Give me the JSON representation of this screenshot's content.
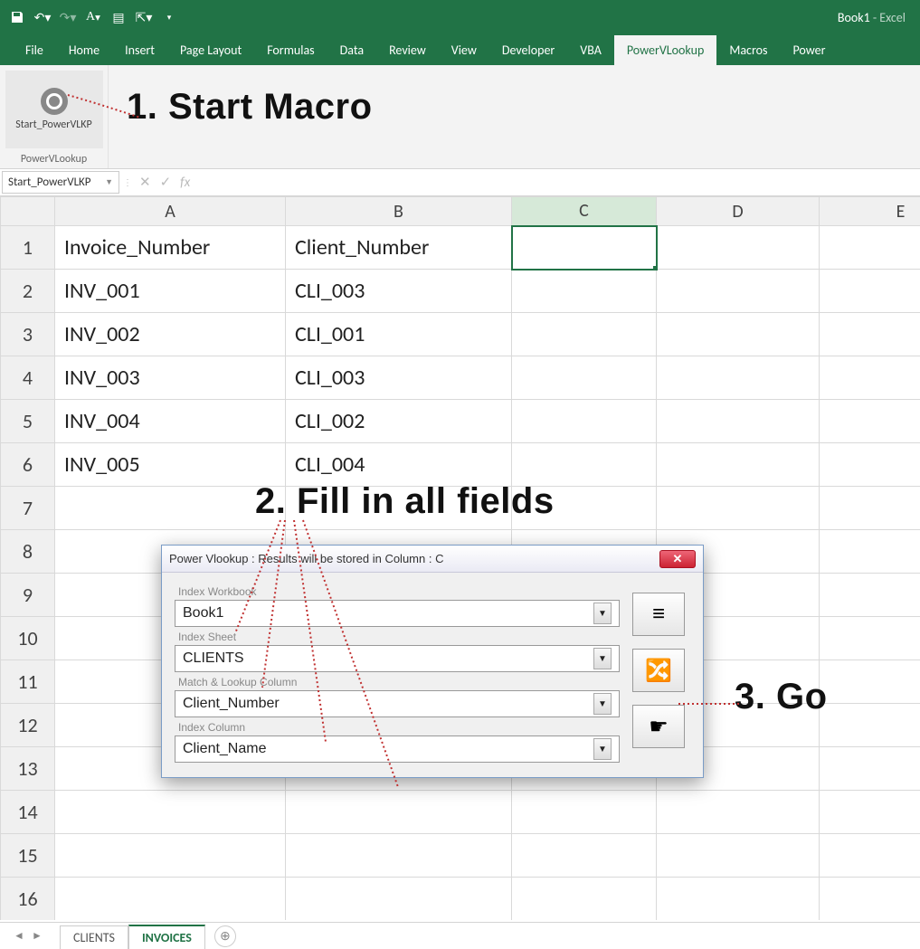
{
  "app": {
    "title": "Book1",
    "suffix": "  -  Excel"
  },
  "tabs": [
    "File",
    "Home",
    "Insert",
    "Page Layout",
    "Formulas",
    "Data",
    "Review",
    "View",
    "Developer",
    "VBA",
    "PowerVLookup",
    "Macros",
    "Power"
  ],
  "active_tab": "PowerVLookup",
  "ribbon": {
    "macro_label": "Start_PowerVLKP",
    "group_label": "PowerVLookup"
  },
  "namebox": "Start_PowerVLKP",
  "columns": [
    "A",
    "B",
    "C",
    "D",
    "E"
  ],
  "rows": [
    1,
    2,
    3,
    4,
    5,
    6,
    7,
    8,
    9,
    10,
    11,
    12,
    13,
    14,
    15,
    16
  ],
  "cells": {
    "A1": "Invoice_Number",
    "B1": "Client_Number",
    "A2": "INV_001",
    "B2": "CLI_003",
    "A3": "INV_002",
    "B3": "CLI_001",
    "A4": "INV_003",
    "B4": "CLI_003",
    "A5": "INV_004",
    "B5": "CLI_002",
    "A6": "INV_005",
    "B6": "CLI_004"
  },
  "selected_cell": "C1",
  "dialog": {
    "title": "Power Vlookup : Results will be stored in Column : C",
    "f1_label": "Index Workbook",
    "f1_value": "Book1",
    "f2_label": "Index Sheet",
    "f2_value": "CLIENTS",
    "f3_label": "Match & Lookup Column",
    "f3_value": "Client_Number",
    "f4_label": "Index Column",
    "f4_value": "Client_Name"
  },
  "sheets": [
    "CLIENTS",
    "INVOICES"
  ],
  "active_sheet": "INVOICES",
  "annotations": {
    "a1": "1. Start Macro",
    "a2": "2. Fill in all fields",
    "a3": "3. Go"
  }
}
